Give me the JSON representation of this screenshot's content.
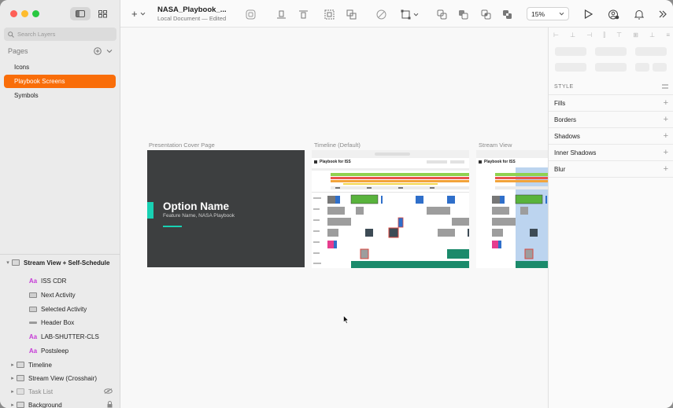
{
  "window": {
    "title": "NASA_Playbook_...",
    "subtitle": "Local Document — Edited"
  },
  "sidebar": {
    "search_placeholder": "Search Layers",
    "pages_header": "Pages",
    "pages": [
      {
        "label": "Icons",
        "active": false
      },
      {
        "label": "Playbook Screens",
        "active": true
      },
      {
        "label": "Symbols",
        "active": false
      }
    ],
    "layers": [
      {
        "label": "Stream View + Self-Schedule",
        "type": "artboard",
        "expanded": true
      },
      {
        "label": "ISS CDR",
        "type": "text"
      },
      {
        "label": "Next Activity",
        "type": "symbol"
      },
      {
        "label": "Selected Activity",
        "type": "symbol"
      },
      {
        "label": "Header Box",
        "type": "line"
      },
      {
        "label": "LAB-SHUTTER-CLS",
        "type": "text"
      },
      {
        "label": "Postsleep",
        "type": "text"
      },
      {
        "label": "Timeline",
        "type": "group"
      },
      {
        "label": "Stream View (Crosshair)",
        "type": "group"
      },
      {
        "label": "Task List",
        "type": "group",
        "hidden": true
      },
      {
        "label": "Background",
        "type": "group",
        "locked": true
      }
    ]
  },
  "toolbar": {
    "zoom": "15%"
  },
  "canvas": {
    "artboards": [
      {
        "label": "Presentation Cover Page"
      },
      {
        "label": "Timeline (Default)"
      },
      {
        "label": "Stream View"
      }
    ],
    "cover": {
      "title": "Option Name",
      "subtitle": "Feature Name, NASA Playbook"
    },
    "mini_header": "Playbook for ISS",
    "colors": {
      "accent": "#f96d09",
      "teal": "#18d1b3",
      "cover_bg": "#3d3f40"
    }
  },
  "inspector": {
    "style_header": "STYLE",
    "sections": [
      "Fills",
      "Borders",
      "Shadows",
      "Inner Shadows",
      "Blur"
    ]
  }
}
